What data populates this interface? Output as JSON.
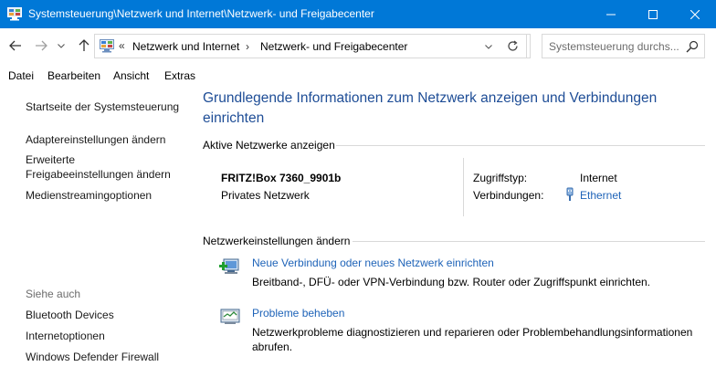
{
  "window": {
    "title": "Systemsteuerung\\Netzwerk und Internet\\Netzwerk- und Freigabecenter"
  },
  "address": {
    "overflow": "«",
    "crumbs": [
      "Netzwerk und Internet",
      "Netzwerk- und Freigabecenter"
    ],
    "separator": "›"
  },
  "search": {
    "placeholder": "Systemsteuerung durchs..."
  },
  "menu": [
    "Datei",
    "Bearbeiten",
    "Ansicht",
    "Extras"
  ],
  "sidebar": {
    "links": [
      "Startseite der Systemsteuerung",
      "Adaptereinstellungen ändern",
      "Erweiterte Freigabeeinstellungen ändern",
      "Medienstreamingoptionen"
    ],
    "links_wrapped": {
      "erweitert_line1": "Erweiterte",
      "erweitert_line2": "Freigabeeinstellungen ändern"
    },
    "see_also_heading": "Siehe auch",
    "see_also": [
      "Bluetooth Devices",
      "Internetoptionen",
      "Windows Defender Firewall"
    ]
  },
  "main": {
    "title": "Grundlegende Informationen zum Netzwerk anzeigen und Verbindungen einrichten",
    "active_networks_label": "Aktive Netzwerke anzeigen",
    "network": {
      "name": "FRITZ!Box 7360_9901b",
      "type": "Privates Netzwerk",
      "access_type_label": "Zugriffstyp:",
      "access_type_value": "Internet",
      "connections_label": "Verbindungen:",
      "connections_value": "Ethernet"
    },
    "change_settings_label": "Netzwerkeinstellungen ändern",
    "tasks": [
      {
        "icon": "new-connection-icon",
        "link": "Neue Verbindung oder neues Netzwerk einrichten",
        "desc": "Breitband-, DFÜ- oder VPN-Verbindung bzw. Router oder Zugriffspunkt einrichten."
      },
      {
        "icon": "troubleshoot-icon",
        "link": "Probleme beheben",
        "desc": "Netzwerkprobleme diagnostizieren und reparieren oder Problembehandlungsinformationen abrufen."
      }
    ]
  },
  "colors": {
    "titlebar": "#0078d7",
    "link": "#1e63b8",
    "heading": "#1e4d96"
  }
}
